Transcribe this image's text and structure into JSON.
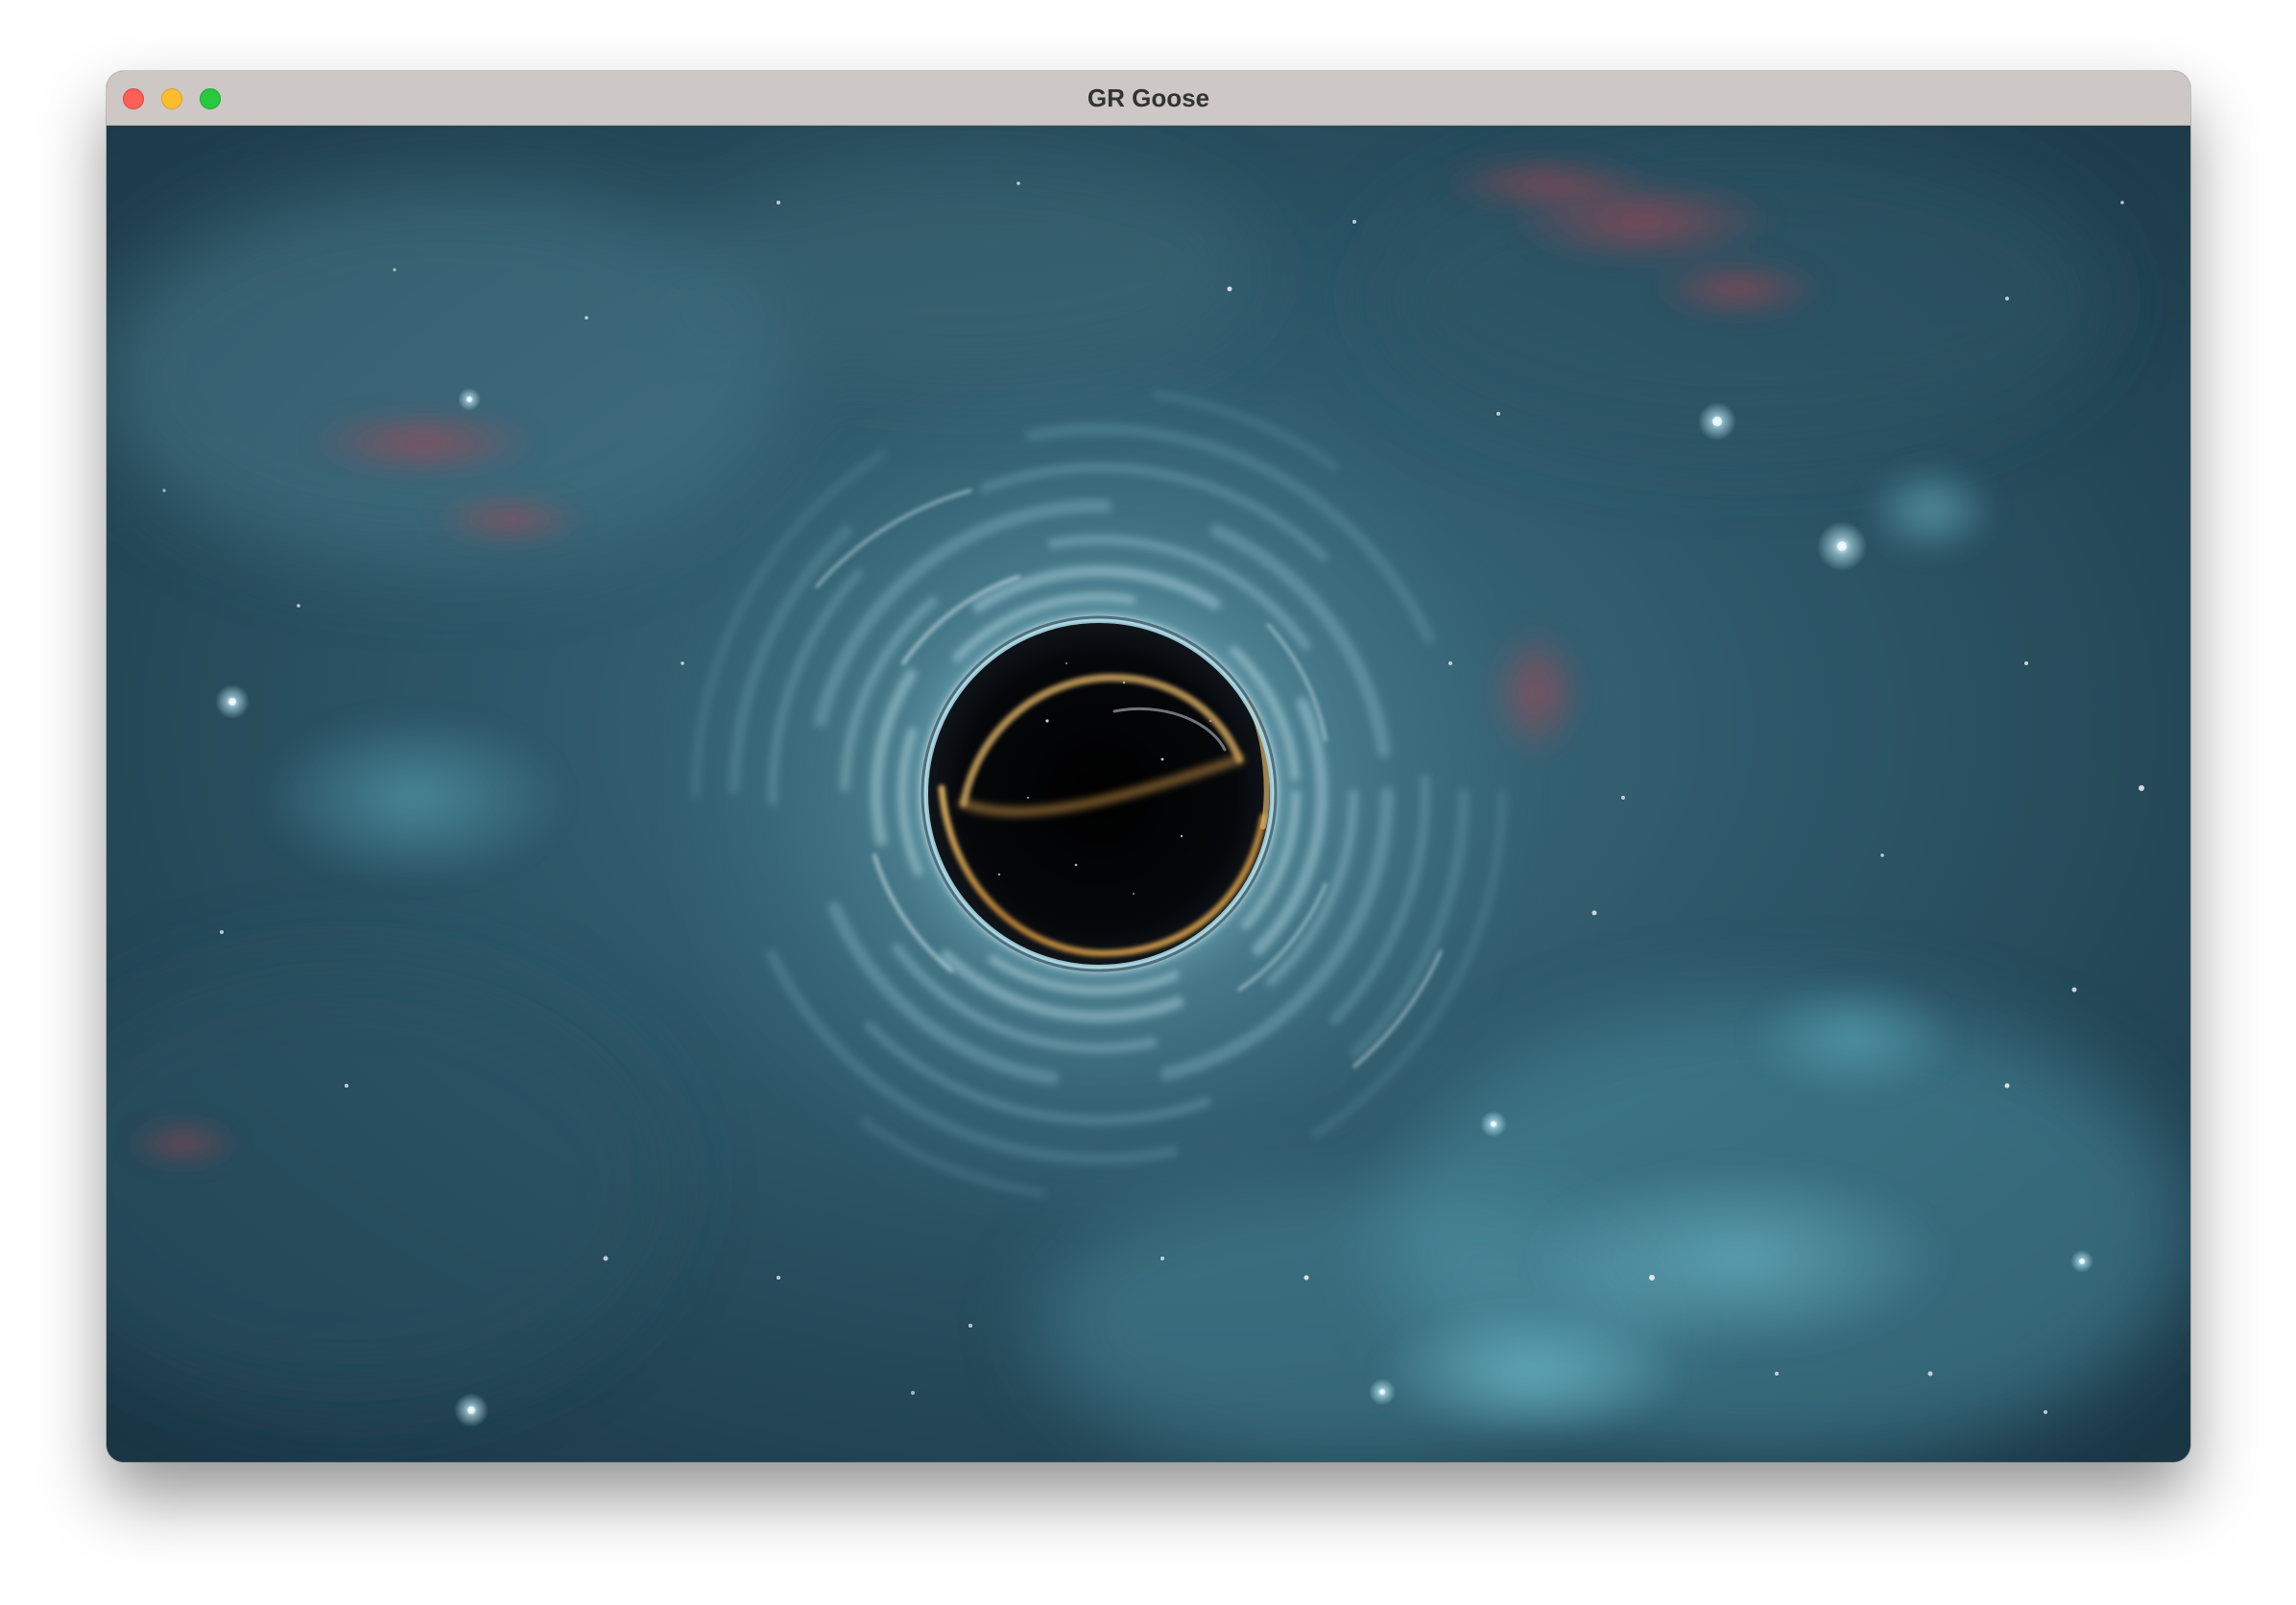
{
  "window": {
    "title": "GR Goose"
  },
  "titlebar_buttons": {
    "close_color": "#fe5f57",
    "minimize_color": "#febc2e",
    "maximize_color": "#28c840"
  },
  "scene": {
    "description_icon": "black-hole-render",
    "colors": {
      "space_base": "#1e3e4e",
      "nebula_teal": "#4a8ea0",
      "nebula_red": "#b83a48",
      "ring_gold": "#d9a24a",
      "shadow": "#000000"
    }
  }
}
